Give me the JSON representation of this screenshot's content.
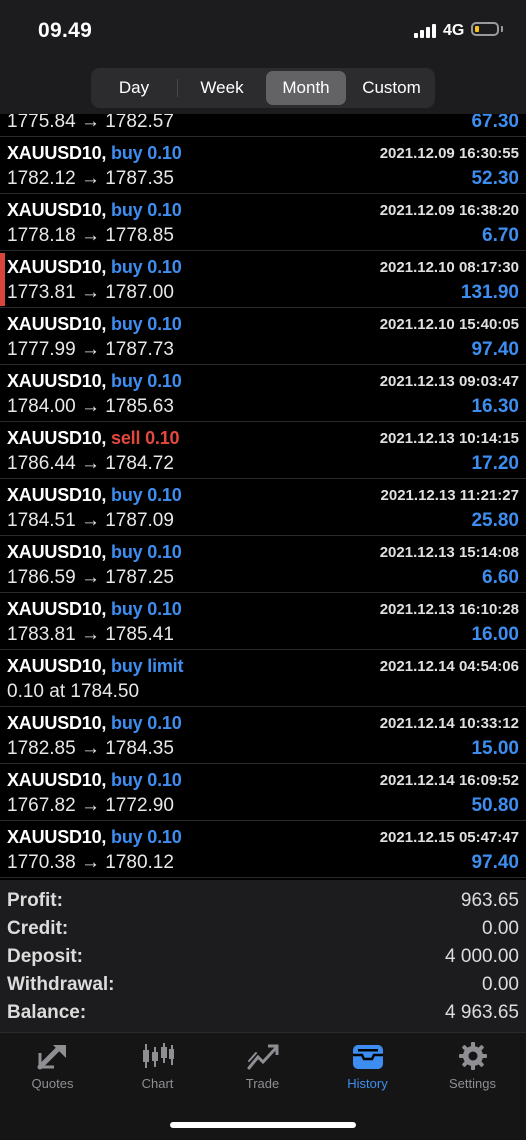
{
  "status_bar": {
    "time": "09.49",
    "network": "4G"
  },
  "period_tabs": [
    {
      "label": "Day",
      "active": false
    },
    {
      "label": "Week",
      "active": false
    },
    {
      "label": "Month",
      "active": true
    },
    {
      "label": "Custom",
      "active": false
    }
  ],
  "orders": [
    {
      "symbol": "XAUUSD10,",
      "side": "buy",
      "detail": "0.10",
      "prices": "1775.84 → 1782.57",
      "datetime": "",
      "profit": "67.30",
      "partial": true
    },
    {
      "symbol": "XAUUSD10,",
      "side": "buy",
      "detail": "0.10",
      "prices": "1782.12 → 1787.35",
      "datetime": "2021.12.09 16:30:55",
      "profit": "52.30"
    },
    {
      "symbol": "XAUUSD10,",
      "side": "buy",
      "detail": "0.10",
      "prices": "1778.18 → 1778.85",
      "datetime": "2021.12.09 16:38:20",
      "profit": "6.70"
    },
    {
      "symbol": "XAUUSD10,",
      "side": "buy",
      "detail": "0.10",
      "prices": "1773.81 → 1787.00",
      "datetime": "2021.12.10 08:17:30",
      "profit": "131.90",
      "marked": true
    },
    {
      "symbol": "XAUUSD10,",
      "side": "buy",
      "detail": "0.10",
      "prices": "1777.99 → 1787.73",
      "datetime": "2021.12.10 15:40:05",
      "profit": "97.40"
    },
    {
      "symbol": "XAUUSD10,",
      "side": "buy",
      "detail": "0.10",
      "prices": "1784.00 → 1785.63",
      "datetime": "2021.12.13 09:03:47",
      "profit": "16.30"
    },
    {
      "symbol": "XAUUSD10,",
      "side": "sell",
      "detail": "0.10",
      "prices": "1786.44 → 1784.72",
      "datetime": "2021.12.13 10:14:15",
      "profit": "17.20"
    },
    {
      "symbol": "XAUUSD10,",
      "side": "buy",
      "detail": "0.10",
      "prices": "1784.51 → 1787.09",
      "datetime": "2021.12.13 11:21:27",
      "profit": "25.80"
    },
    {
      "symbol": "XAUUSD10,",
      "side": "buy",
      "detail": "0.10",
      "prices": "1786.59 → 1787.25",
      "datetime": "2021.12.13 15:14:08",
      "profit": "6.60"
    },
    {
      "symbol": "XAUUSD10,",
      "side": "buy",
      "detail": "0.10",
      "prices": "1783.81 → 1785.41",
      "datetime": "2021.12.13 16:10:28",
      "profit": "16.00"
    },
    {
      "symbol": "XAUUSD10,",
      "side": "buy",
      "detail": "limit",
      "prices": "0.10 at 1784.50",
      "datetime": "2021.12.14 04:54:06",
      "profit": ""
    },
    {
      "symbol": "XAUUSD10,",
      "side": "buy",
      "detail": "0.10",
      "prices": "1782.85 → 1784.35",
      "datetime": "2021.12.14 10:33:12",
      "profit": "15.00"
    },
    {
      "symbol": "XAUUSD10,",
      "side": "buy",
      "detail": "0.10",
      "prices": "1767.82 → 1772.90",
      "datetime": "2021.12.14 16:09:52",
      "profit": "50.80"
    },
    {
      "symbol": "XAUUSD10,",
      "side": "buy",
      "detail": "0.10",
      "prices": "1770.38 → 1780.12",
      "datetime": "2021.12.15 05:47:47",
      "profit": "97.40"
    }
  ],
  "summary": [
    {
      "label": "Profit:",
      "value": "963.65"
    },
    {
      "label": "Credit:",
      "value": "0.00"
    },
    {
      "label": "Deposit:",
      "value": "4 000.00"
    },
    {
      "label": "Withdrawal:",
      "value": "0.00"
    },
    {
      "label": "Balance:",
      "value": "4 963.65"
    }
  ],
  "tabs": [
    {
      "label": "Quotes",
      "icon": "quotes-icon",
      "active": false
    },
    {
      "label": "Chart",
      "icon": "chart-icon",
      "active": false
    },
    {
      "label": "Trade",
      "icon": "trade-icon",
      "active": false
    },
    {
      "label": "History",
      "icon": "history-icon",
      "active": true
    },
    {
      "label": "Settings",
      "icon": "settings-icon",
      "active": false
    }
  ],
  "colors": {
    "buy": "#3d8ef0",
    "sell": "#e5483d",
    "marker": "#d9453a",
    "active_tab": "#3d8ef0",
    "inactive_tab": "#8e8e93"
  }
}
